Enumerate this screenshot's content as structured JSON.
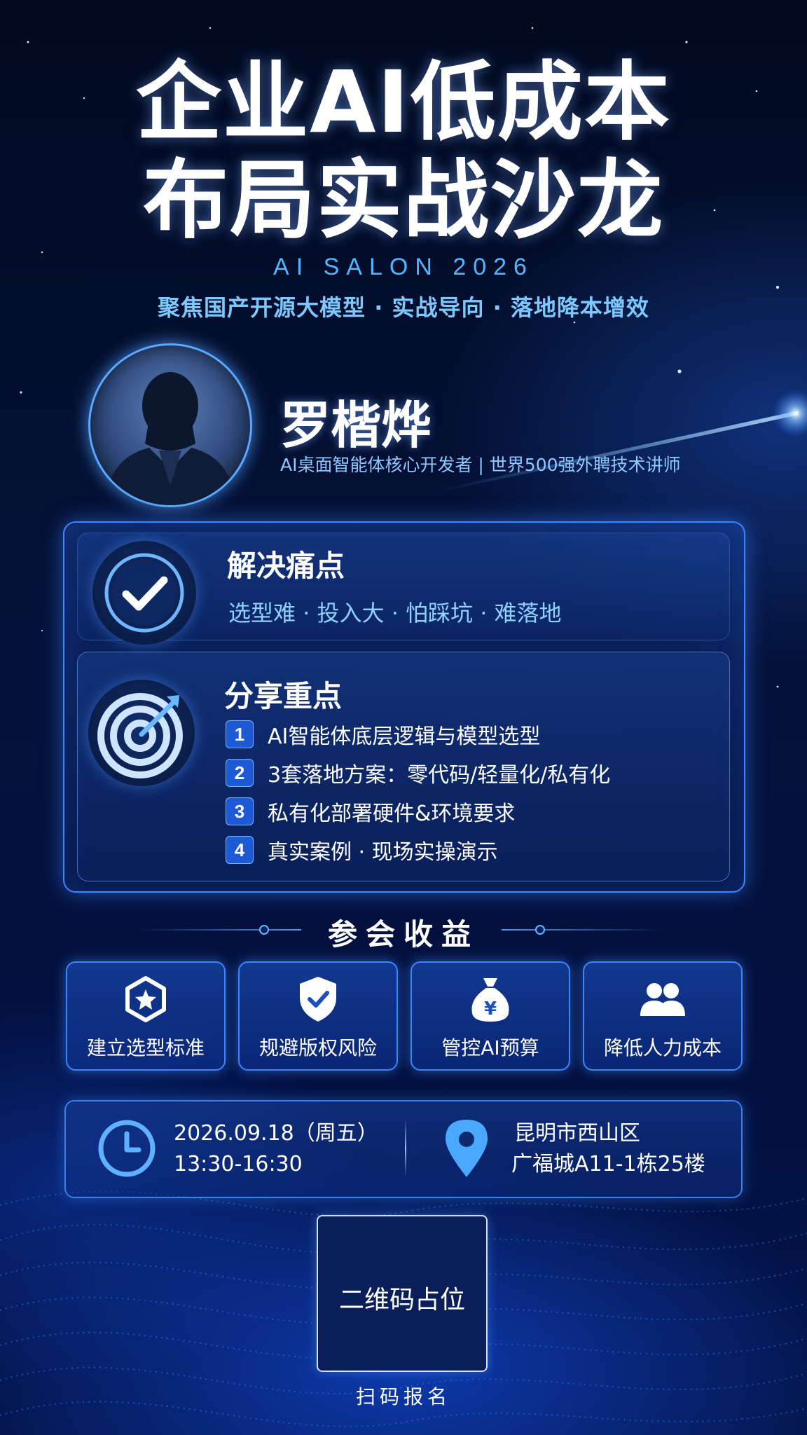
{
  "header": {
    "title_line1": "企业AI低成本",
    "title_line2": "布局实战沙龙",
    "subtitle_en": "AI SALON 2026",
    "tagline": "聚焦国产开源大模型 · 实战导向 · 落地降本增效"
  },
  "speaker": {
    "name": "罗楷烨",
    "title": "AI桌面智能体核心开发者 | 世界500强外聘技术讲师",
    "avatar_icon": "person-silhouette-icon"
  },
  "pain_points": {
    "heading": "解决痛点",
    "text": "选型难 · 投入大 · 怕踩坑 · 难落地",
    "icon": "checkmark-icon"
  },
  "share": {
    "heading": "分享重点",
    "icon": "target-icon",
    "items": [
      {
        "num": "1",
        "text": "AI智能体底层逻辑与模型选型"
      },
      {
        "num": "2",
        "text": "3套落地方案：零代码/轻量化/私有化"
      },
      {
        "num": "3",
        "text": "私有化部署硬件&环境要求"
      },
      {
        "num": "4",
        "text": "真实案例 · 现场实操演示"
      }
    ]
  },
  "benefits": {
    "heading": "参会收益",
    "items": [
      {
        "label": "建立选型标准",
        "icon": "star-hexagon-icon"
      },
      {
        "label": "规避版权风险",
        "icon": "shield-check-icon"
      },
      {
        "label": "管控AI预算",
        "icon": "money-bag-icon"
      },
      {
        "label": "降低人力成本",
        "icon": "people-icon"
      }
    ]
  },
  "event": {
    "date": "2026.09.18（周五）",
    "time": "13:30-16:30",
    "location_line1": "昆明市西山区",
    "location_line2": "广福城A11-1栋25楼",
    "clock_icon": "clock-icon",
    "location_icon": "location-pin-icon"
  },
  "signup": {
    "qr_placeholder": "二维码占位",
    "scan_label": "扫码报名"
  },
  "colors": {
    "background": "#030b22",
    "accent": "#3a86ff",
    "highlight_text": "#8fd0ff"
  }
}
